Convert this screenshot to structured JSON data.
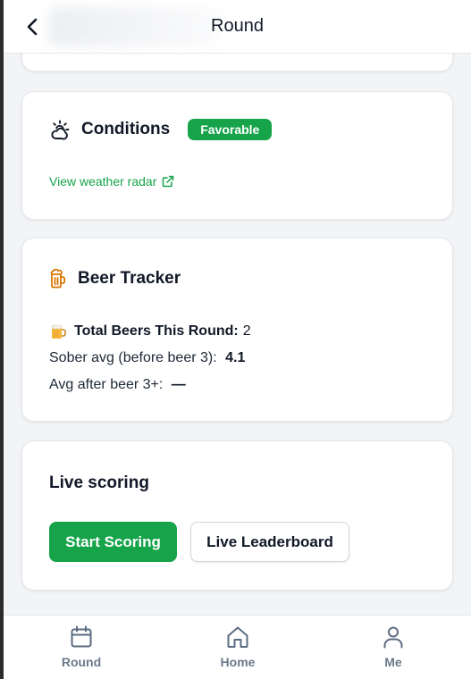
{
  "header": {
    "title": "Round",
    "back_icon": "chevron-left-icon"
  },
  "conditions": {
    "icon": "cloud-sun-icon",
    "title": "Conditions",
    "badge": "Favorable",
    "radar_link": "View weather radar",
    "link_icon": "external-link-icon"
  },
  "beer_tracker": {
    "icon": "beer-mug-icon",
    "title": "Beer Tracker",
    "total_label": "Total Beers This Round:",
    "total_value": "2",
    "sober_label": "Sober avg (before beer 3):",
    "sober_value": "4.1",
    "after_label": "Avg after beer 3+:",
    "after_value": "—"
  },
  "live_scoring": {
    "title": "Live scoring",
    "start_button": "Start Scoring",
    "leaderboard_button": "Live Leaderboard"
  },
  "bottom_nav": {
    "items": [
      {
        "label": "Round",
        "icon": "calendar-icon"
      },
      {
        "label": "Home",
        "icon": "home-icon"
      },
      {
        "label": "Me",
        "icon": "user-icon"
      }
    ]
  },
  "colors": {
    "accent": "#16a34a",
    "beer_icon": "#d97706",
    "nav_icon": "#5b6b80",
    "background": "#f3f4f6"
  }
}
